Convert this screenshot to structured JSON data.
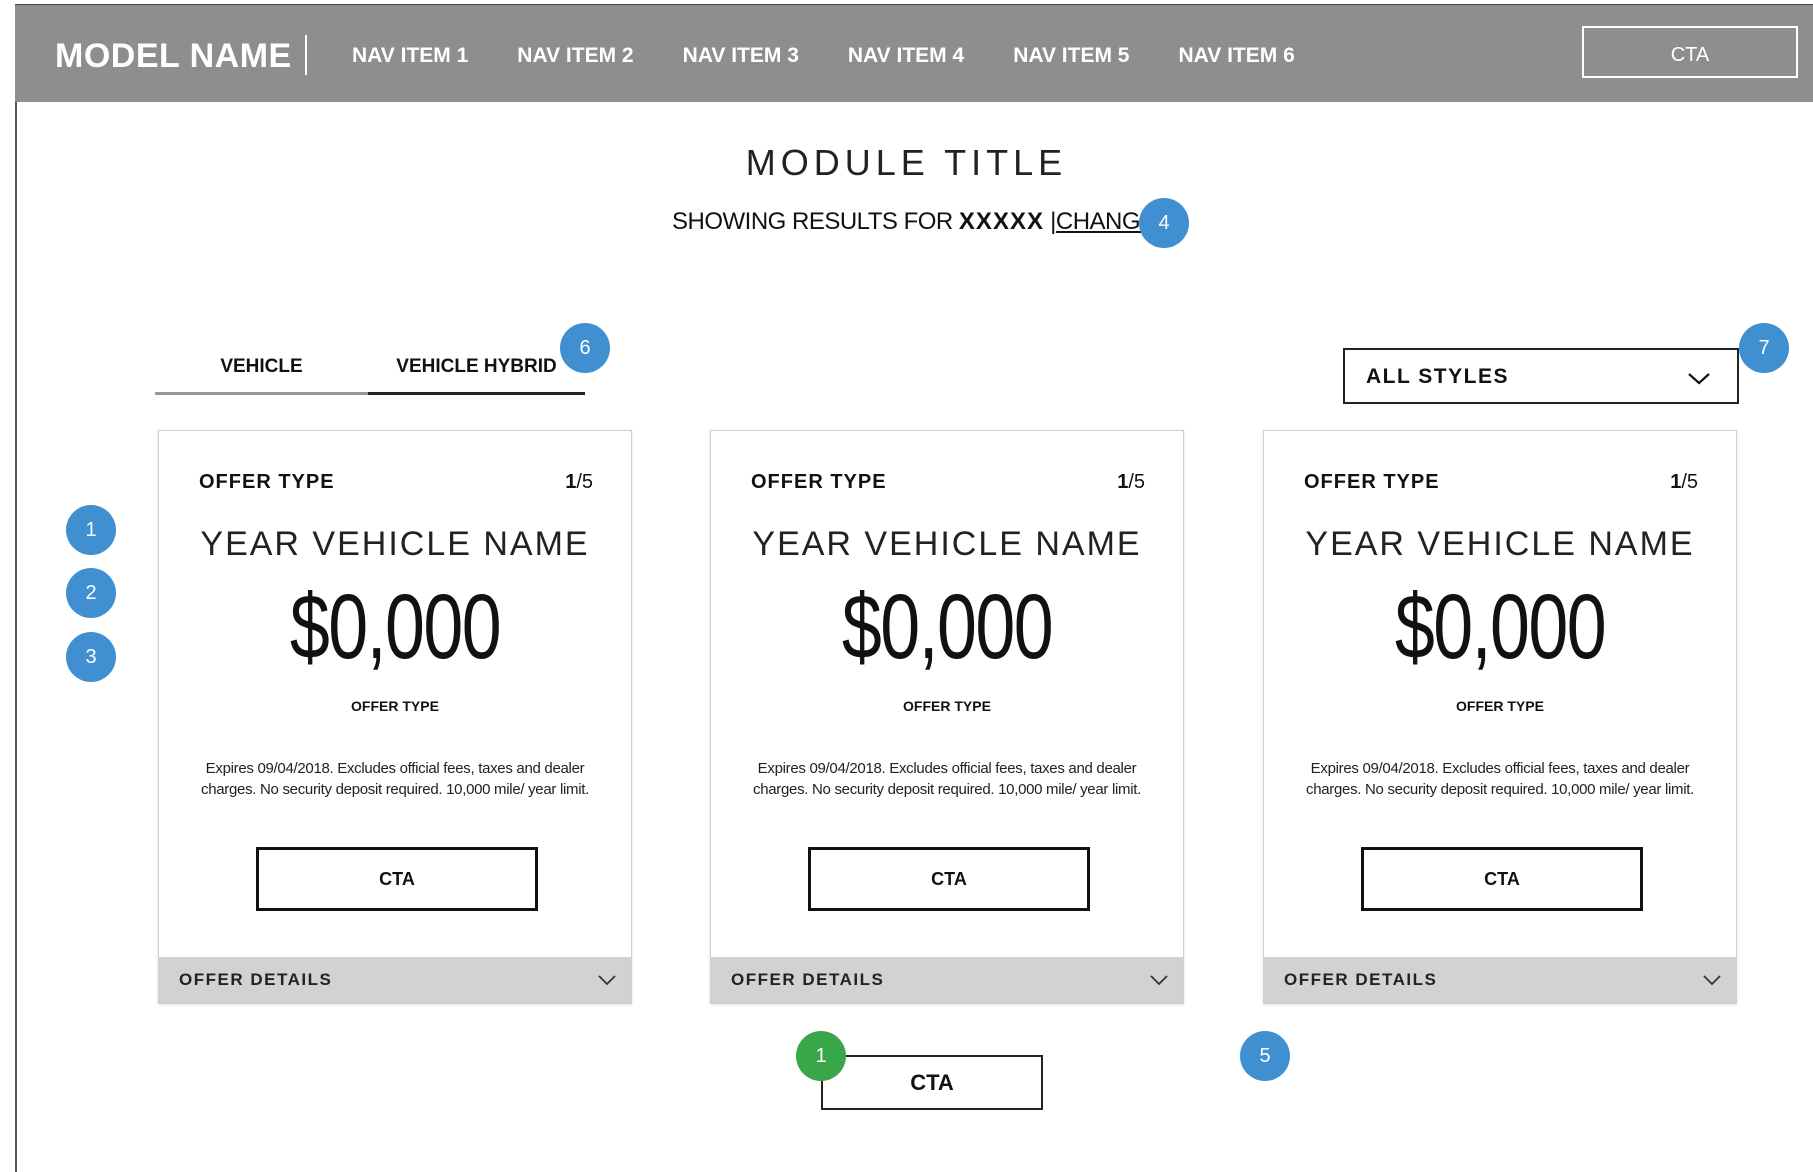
{
  "header": {
    "model_name": "MODEL NAME",
    "nav_items": [
      "NAV ITEM 1",
      "NAV ITEM 2",
      "NAV ITEM 3",
      "NAV ITEM 4",
      "NAV ITEM 5",
      "NAV ITEM 6"
    ],
    "cta_label": "CTA",
    "background_color": "#8e8e8e"
  },
  "module": {
    "title": "MODULE TITLE",
    "results_prefix": "SHOWING RESULTS FOR",
    "results_value": "XXXXX",
    "separator": "|",
    "change_label": "CHANGE"
  },
  "tabs": [
    {
      "label": "VEHICLE",
      "active": false
    },
    {
      "label": "VEHICLE HYBRID",
      "active": true
    }
  ],
  "filter": {
    "selected": "ALL STYLES",
    "icon": "chevron-down-icon"
  },
  "cards": [
    {
      "offer_type": "OFFER TYPE",
      "current": "1",
      "total": "/5",
      "vehicle_name": "YEAR VEHICLE NAME",
      "price": "$0,000",
      "price_label": "OFFER TYPE",
      "disclaimer": "Expires 09/04/2018. Excludes official fees, taxes and dealer charges. No security deposit required. 10,000 mile/ year limit.",
      "cta_label": "CTA",
      "details_label": "OFFER DETAILS"
    },
    {
      "offer_type": "OFFER TYPE",
      "current": "1",
      "total": "/5",
      "vehicle_name": "YEAR VEHICLE NAME",
      "price": "$0,000",
      "price_label": "OFFER TYPE",
      "disclaimer": "Expires 09/04/2018. Excludes official fees, taxes and dealer charges. No security deposit required. 10,000 mile/ year limit.",
      "cta_label": "CTA",
      "details_label": "OFFER DETAILS"
    },
    {
      "offer_type": "OFFER TYPE",
      "current": "1",
      "total": "/5",
      "vehicle_name": "YEAR VEHICLE NAME",
      "price": "$0,000",
      "price_label": "OFFER TYPE",
      "disclaimer": "Expires 09/04/2018. Excludes official fees, taxes and dealer charges. No security deposit required. 10,000 mile/ year limit.",
      "cta_label": "CTA",
      "details_label": "OFFER DETAILS"
    }
  ],
  "bottom_cta": {
    "label": "CTA"
  },
  "annotations": {
    "left_markers": [
      "1",
      "2",
      "3"
    ],
    "change_marker": "4",
    "card_marker": "5",
    "tab_marker": "6",
    "filter_marker": "7",
    "cta_marker": "1",
    "blue_color": "#3f8fd1",
    "green_color": "#3aa64a"
  }
}
